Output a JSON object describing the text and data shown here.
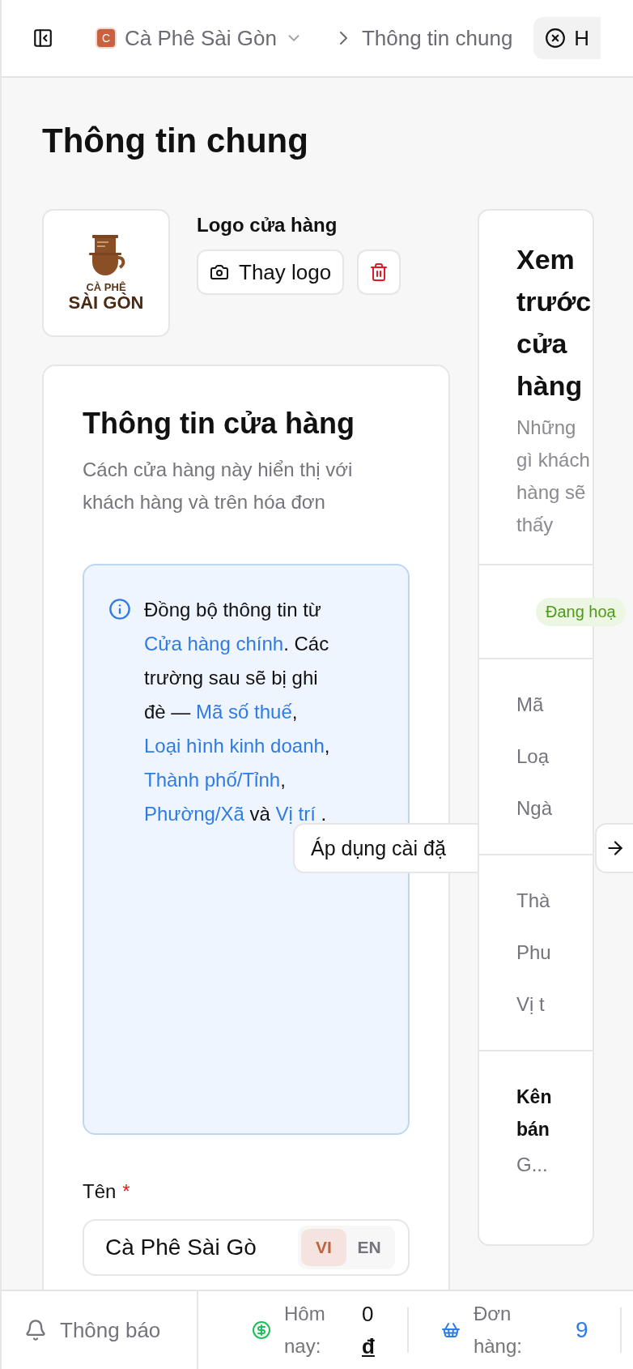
{
  "topbar": {
    "store": {
      "initial": "C",
      "name": "Cà Phê Sài Gòn"
    },
    "page": "Thông tin chung",
    "tab": {
      "label": "H"
    }
  },
  "title": "Thông tin chung",
  "logo": {
    "line_1": "CÀ PHÊ",
    "line_2": "SÀI GÒN",
    "label": "Logo cửa hàng",
    "change_button": "Thay logo"
  },
  "store_info": {
    "title": "Thông tin cửa hàng",
    "subtitle": "Cách cửa hàng này hiển thị với khách hàng và trên hóa đơn",
    "notice": [
      {
        "kind": "text",
        "text": "Đồng bộ thông tin từ "
      },
      {
        "kind": "link",
        "text": "Cửa hàng chính"
      },
      {
        "kind": "text",
        "text": ". Các trường sau sẽ bị ghi đè — "
      },
      {
        "kind": "link",
        "text": "Mã số thuế"
      },
      {
        "kind": "text",
        "text": ", "
      },
      {
        "kind": "link",
        "text": "Loại hình kinh doanh"
      },
      {
        "kind": "text",
        "text": ", "
      },
      {
        "kind": "link",
        "text": "Thành phố/Tỉnh"
      },
      {
        "kind": "text",
        "text": ", "
      },
      {
        "kind": "link",
        "text": "Phường/Xã"
      },
      {
        "kind": "text",
        "text": " và "
      },
      {
        "kind": "link",
        "text": "Vị trí"
      },
      {
        "kind": "text",
        "text": " ."
      }
    ],
    "apply_button": "Áp dụng cài đặ",
    "name_field": {
      "label": "Tên",
      "required_mark": "*",
      "value": "Cà Phê Sài Gò",
      "languages": [
        {
          "label": "VI",
          "selected": true
        },
        {
          "label": "EN",
          "selected": false
        }
      ]
    }
  },
  "preview": {
    "title": "Xem trước cửa hàng",
    "subtitle": "Những gì khách hàng sẽ thấy",
    "status": "Đang hoạ",
    "sections": [
      {
        "kind": "rows",
        "rows": [
          "Mã",
          "Loạ",
          "Ngà"
        ]
      },
      {
        "kind": "rows",
        "rows": [
          "Thà",
          "Phu",
          "Vị t"
        ]
      },
      {
        "kind": "heading",
        "title": "Kên bán",
        "value": "G..."
      }
    ]
  },
  "status_bar": {
    "notifications": "Thông báo",
    "today": {
      "label": "Hôm nay:",
      "amount": "0",
      "currency": "đ"
    },
    "orders": {
      "label": "Đơn hàng:",
      "count": "9"
    }
  }
}
